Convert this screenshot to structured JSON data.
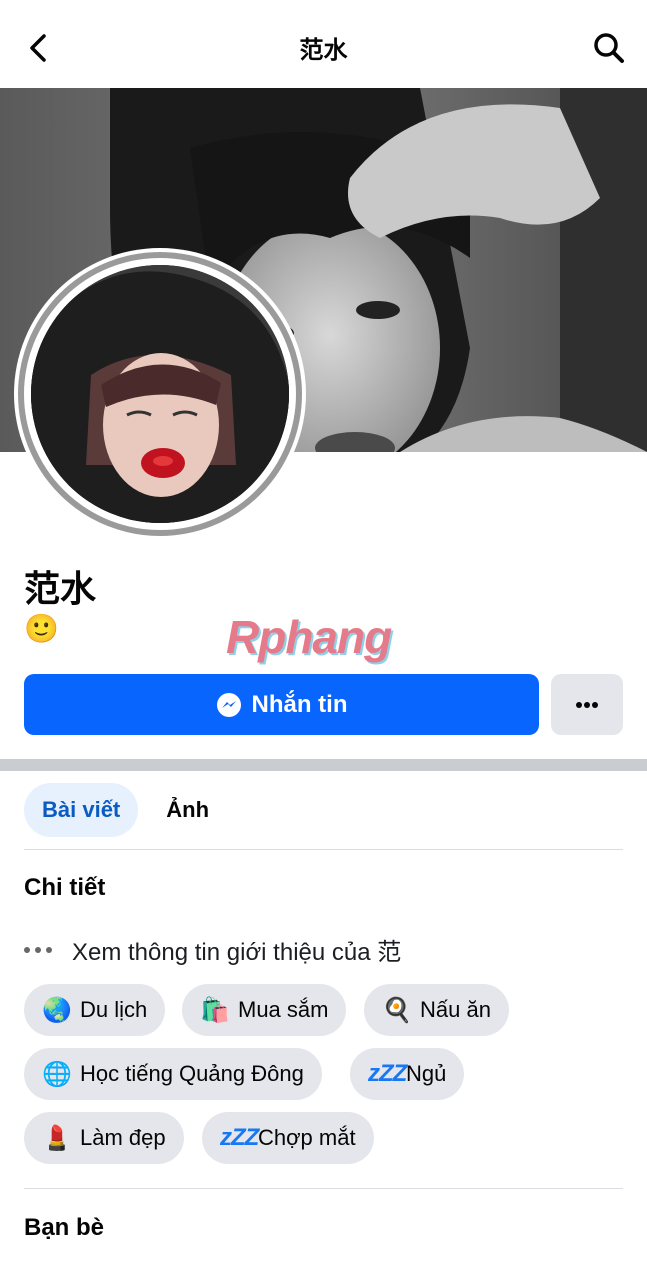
{
  "header": {
    "title": "范水",
    "back_icon": "chevron-left-icon",
    "search_icon": "search-icon"
  },
  "profile": {
    "name": "范水",
    "bio_emoji": "🙂",
    "watermark": "Rphang"
  },
  "actions": {
    "message_label": "Nhắn tin",
    "more_label": "•••"
  },
  "tabs": [
    {
      "label": "Bài viết",
      "active": true
    },
    {
      "label": "Ảnh",
      "active": false
    }
  ],
  "details": {
    "title": "Chi tiết",
    "about_text": "Xem thông tin giới thiệu của 范"
  },
  "hobbies": [
    {
      "icon": "🌏",
      "label": "Du lịch"
    },
    {
      "icon": "🛍️",
      "label": "Mua sắm"
    },
    {
      "icon": "🍳",
      "label": "Nấu ăn"
    },
    {
      "icon": "🌐",
      "label": "Học tiếng Quảng Đông"
    },
    {
      "icon": "zZZ",
      "label": "Ngủ"
    },
    {
      "icon": "💄",
      "label": "Làm đẹp"
    },
    {
      "icon": "zZZ",
      "label": "Chợp mắt"
    }
  ],
  "friends": {
    "title": "Bạn bè"
  },
  "colors": {
    "primary": "#0866ff",
    "tab_active_bg": "#e7f0fd",
    "chip_bg": "#e4e6eb"
  }
}
